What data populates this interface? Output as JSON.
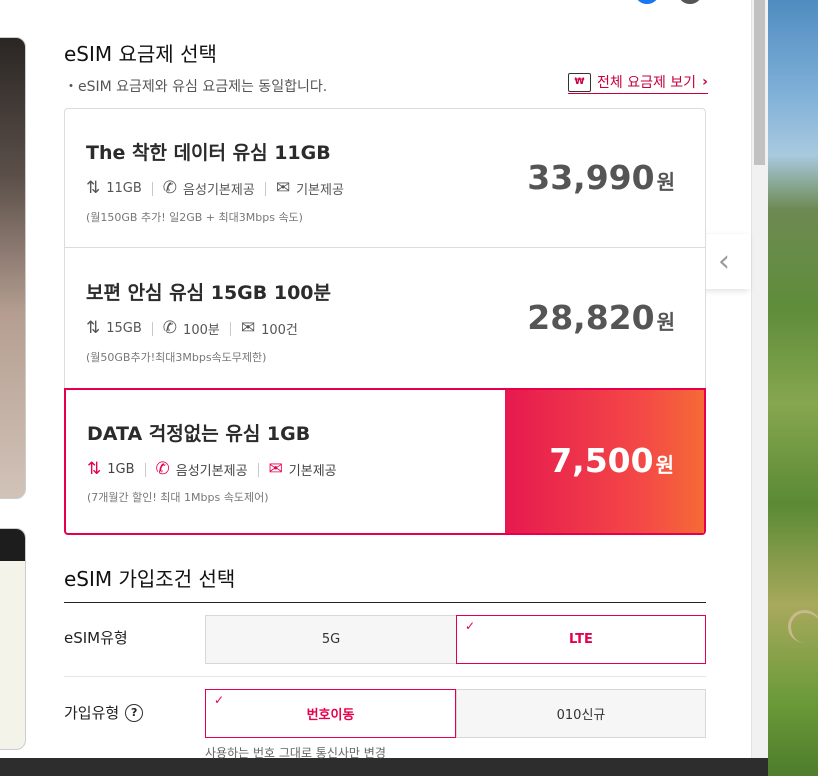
{
  "plan_section": {
    "title": "eSIM 요금제 선택",
    "note": "・eSIM 요금제와 유심 요금제는 동일합니다.",
    "all_plans_link": "전체 요금제 보기",
    "all_plans_icon": "₩"
  },
  "plans": [
    {
      "name": "The 착한 데이터 유심 11GB",
      "data": "11GB",
      "voice": "음성기본제공",
      "sms": "기본제공",
      "fine_print": "(월150GB 추가! 일2GB + 최대3Mbps 속도)",
      "price": "33,990",
      "unit": "원",
      "selected": false
    },
    {
      "name": "보편 안심 유심 15GB 100분",
      "data": "15GB",
      "voice": "100분",
      "sms": "100건",
      "fine_print": "(월50GB추가!최대3Mbps속도무제한)",
      "price": "28,820",
      "unit": "원",
      "selected": false
    },
    {
      "name": "DATA 걱정없는 유심 1GB",
      "data": "1GB",
      "voice": "음성기본제공",
      "sms": "기본제공",
      "fine_print": "(7개월간 할인! 최대 1Mbps 속도제어)",
      "price": "7,500",
      "unit": "원",
      "selected": true
    }
  ],
  "condition_section": {
    "title": "eSIM 가입조건 선택",
    "esim_type": {
      "label": "eSIM유형",
      "options": [
        "5G",
        "LTE"
      ],
      "selected": "LTE"
    },
    "join_type": {
      "label": "가입유형",
      "help": "?",
      "options": [
        "번호이동",
        "010신규"
      ],
      "selected": "번호이동",
      "helper_text": "사용하는 번호 그대로 통신사만 변경"
    }
  },
  "icons": {
    "data": "up-down-arrows-icon",
    "voice": "phone-icon",
    "sms": "envelope-icon",
    "check": "✓",
    "side_arrow": "‹"
  },
  "colors": {
    "accent": "#e6004c",
    "gradient_start": "#e6194f",
    "gradient_end": "#f56a36"
  }
}
